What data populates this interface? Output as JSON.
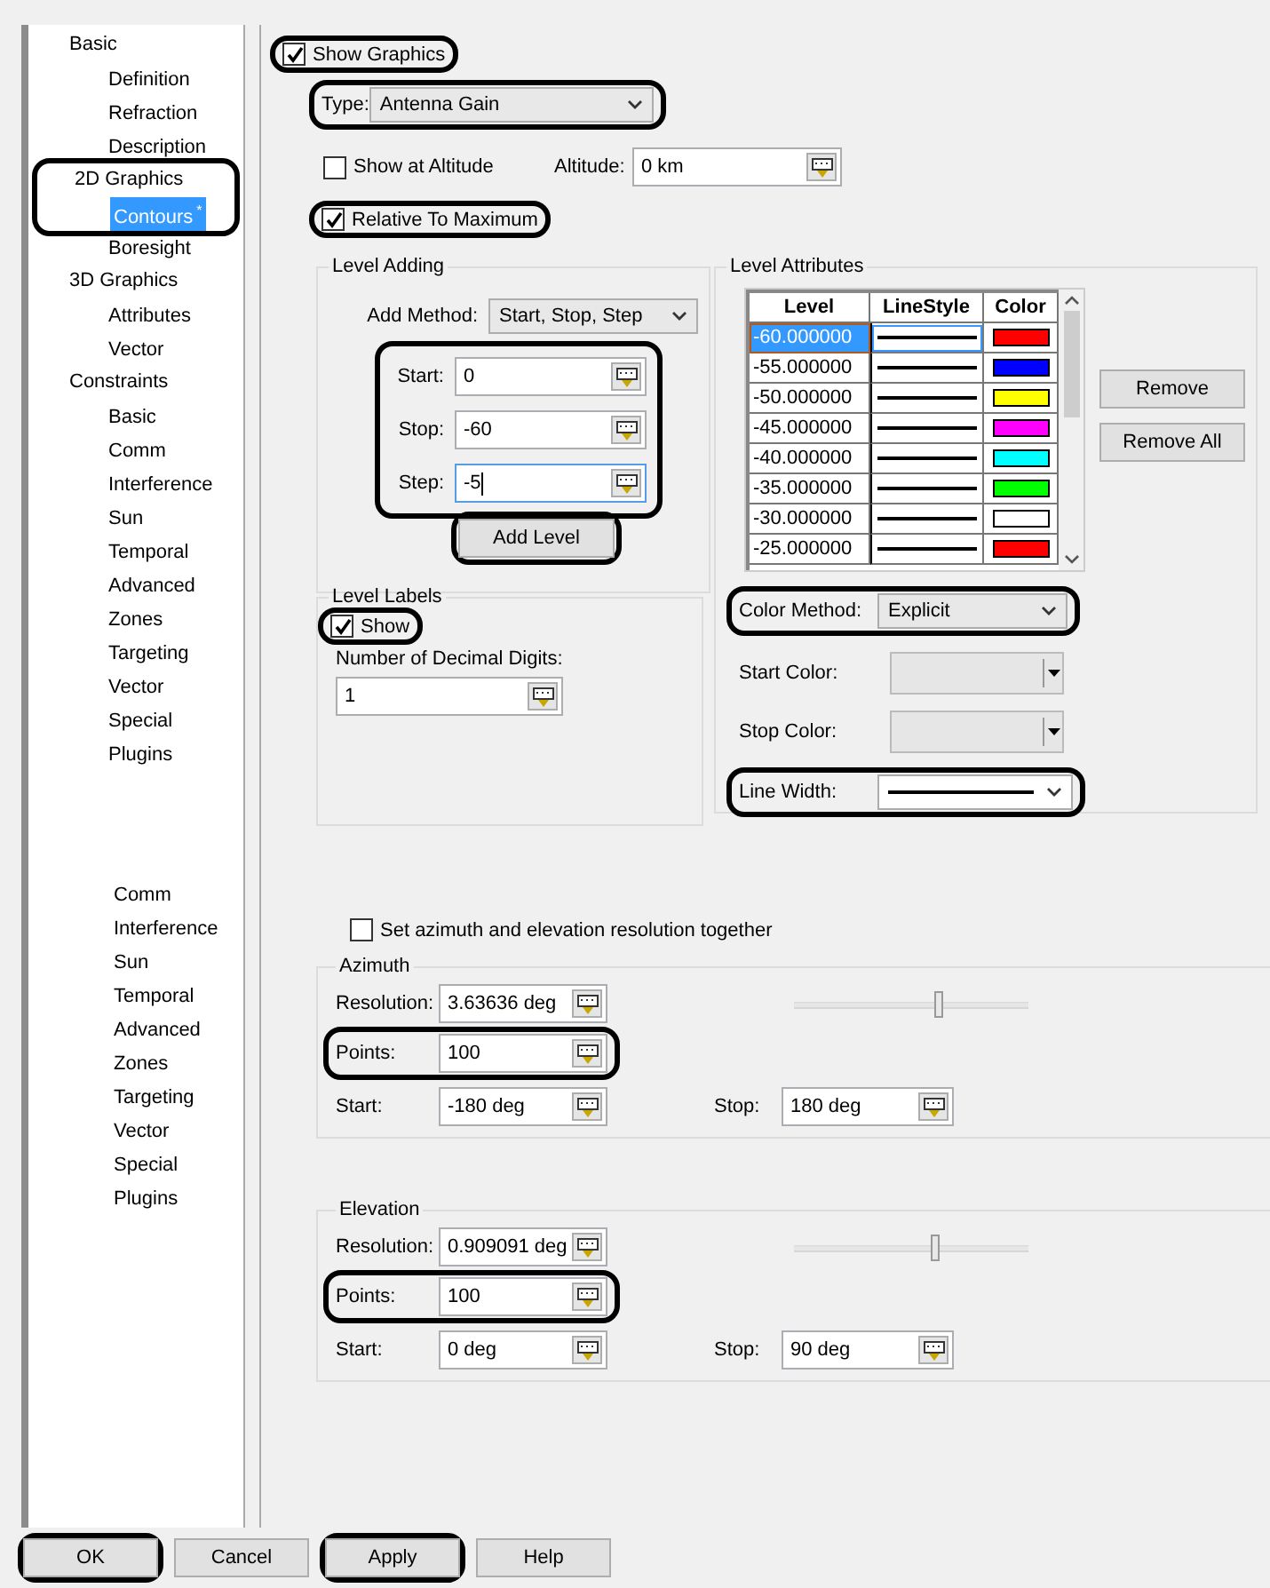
{
  "sidebar": {
    "tree": [
      {
        "label": "Basic",
        "selected": false,
        "highlighted": false,
        "children": [
          {
            "label": "Definition",
            "selected": false,
            "highlighted": false
          },
          {
            "label": "Refraction",
            "selected": false,
            "highlighted": false
          },
          {
            "label": "Description",
            "selected": false,
            "highlighted": false
          }
        ]
      },
      {
        "label": "2D Graphics",
        "selected": false,
        "highlighted": true,
        "children": [
          {
            "label": "Contours",
            "mark": "*",
            "selected": true,
            "highlighted": true
          },
          {
            "label": "Boresight",
            "selected": false,
            "highlighted": false
          }
        ]
      },
      {
        "label": "3D Graphics",
        "selected": false,
        "highlighted": false,
        "children": [
          {
            "label": "Attributes",
            "selected": false,
            "highlighted": false
          },
          {
            "label": "Vector",
            "selected": false,
            "highlighted": false
          }
        ]
      },
      {
        "label": "Constraints",
        "selected": false,
        "highlighted": false,
        "children": [
          {
            "label": "Basic",
            "selected": false,
            "highlighted": false
          },
          {
            "label": "Comm",
            "selected": false,
            "highlighted": false
          },
          {
            "label": "Interference",
            "selected": false,
            "highlighted": false
          },
          {
            "label": "Sun",
            "selected": false,
            "highlighted": false
          },
          {
            "label": "Temporal",
            "selected": false,
            "highlighted": false
          },
          {
            "label": "Advanced",
            "selected": false,
            "highlighted": false
          },
          {
            "label": "Zones",
            "selected": false,
            "highlighted": false
          },
          {
            "label": "Targeting",
            "selected": false,
            "highlighted": false
          },
          {
            "label": "Vector",
            "selected": false,
            "highlighted": false
          },
          {
            "label": "Special",
            "selected": false,
            "highlighted": false
          },
          {
            "label": "Plugins",
            "selected": false,
            "highlighted": false
          }
        ]
      }
    ],
    "extra_items": [
      "Comm",
      "Interference",
      "Sun",
      "Temporal",
      "Advanced",
      "Zones",
      "Targeting",
      "Vector",
      "Special",
      "Plugins"
    ]
  },
  "show_graphics": {
    "label": "Show Graphics",
    "checked": true,
    "highlighted": true
  },
  "type": {
    "label": "Type:",
    "value": "Antenna Gain",
    "highlighted": true
  },
  "show_at_altitude": {
    "label": "Show at Altitude",
    "checked": false
  },
  "altitude": {
    "label": "Altitude:",
    "value": "0 km"
  },
  "relative_to_maximum": {
    "label": "Relative To Maximum",
    "checked": true,
    "highlighted": true
  },
  "level_adding": {
    "title": "Level Adding",
    "add_method": {
      "label": "Add Method:",
      "value": "Start, Stop, Step"
    },
    "fields_highlighted": true,
    "fields": [
      {
        "label": "Start:",
        "value": "0",
        "focused": false
      },
      {
        "label": "Stop:",
        "value": "-60",
        "focused": false
      },
      {
        "label": "Step:",
        "value": "-5",
        "focused": true
      }
    ],
    "add_button": {
      "label": "Add Level",
      "highlighted": true
    }
  },
  "level_labels": {
    "title": "Level Labels",
    "show": {
      "label": "Show",
      "checked": true,
      "highlighted": true
    },
    "decimal_digits": {
      "label": "Number of Decimal Digits:",
      "value": "1"
    }
  },
  "level_attributes": {
    "title": "Level Attributes",
    "table": {
      "columns": [
        "Level",
        "LineStyle",
        "Color"
      ],
      "rows": [
        {
          "level": "-60.000000",
          "color": "#ff0000",
          "selected": true
        },
        {
          "level": "-55.000000",
          "color": "#0000ff",
          "selected": false
        },
        {
          "level": "-50.000000",
          "color": "#ffff00",
          "selected": false
        },
        {
          "level": "-45.000000",
          "color": "#ff00ff",
          "selected": false
        },
        {
          "level": "-40.000000",
          "color": "#00ffff",
          "selected": false
        },
        {
          "level": "-35.000000",
          "color": "#00ff00",
          "selected": false
        },
        {
          "level": "-30.000000",
          "color": "#ffffff",
          "selected": false
        },
        {
          "level": "-25.000000",
          "color": "#ff0000",
          "selected": false
        }
      ]
    },
    "buttons": [
      "Remove",
      "Remove All"
    ],
    "color_method": {
      "label": "Color Method:",
      "value": "Explicit",
      "highlighted": true
    },
    "start_color": {
      "label": "Start Color:",
      "disabled": true
    },
    "stop_color": {
      "label": "Stop Color:",
      "disabled": true
    },
    "line_width": {
      "label": "Line Width:",
      "highlighted": true
    }
  },
  "set_together": {
    "label": "Set azimuth and elevation resolution together",
    "checked": false
  },
  "resolution_groups": [
    {
      "title": "Azimuth",
      "resolution": {
        "label": "Resolution:",
        "value": "3.63636 deg"
      },
      "slider": {
        "level": 0.6
      },
      "points": {
        "label": "Points:",
        "value": "100",
        "highlighted": true
      },
      "start": {
        "label": "Start:",
        "value": "-180 deg"
      },
      "stop": {
        "label": "Stop:",
        "value": "180 deg"
      }
    },
    {
      "title": "Elevation",
      "resolution": {
        "label": "Resolution:",
        "value": "0.909091 deg"
      },
      "slider": {
        "level": 0.58
      },
      "points": {
        "label": "Points:",
        "value": "100",
        "highlighted": true
      },
      "start": {
        "label": "Start:",
        "value": "0 deg"
      },
      "stop": {
        "label": "Stop:",
        "value": "90 deg"
      }
    }
  ],
  "buttons": [
    {
      "label": "OK",
      "highlighted": true
    },
    {
      "label": "Cancel",
      "highlighted": false
    },
    {
      "label": "Apply",
      "highlighted": true
    },
    {
      "label": "Help",
      "highlighted": false
    }
  ]
}
